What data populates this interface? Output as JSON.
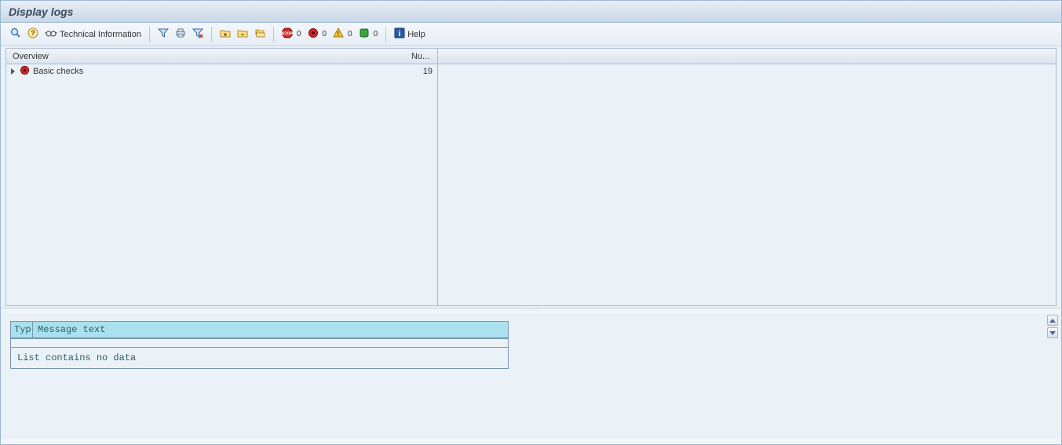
{
  "title": "Display logs",
  "toolbar": {
    "tech_info_label": "Technical Information",
    "help_label": "Help",
    "counts": {
      "stop": "0",
      "error": "0",
      "warning": "0",
      "success": "0"
    }
  },
  "tree": {
    "header_overview": "Overview",
    "header_num": "Nu...",
    "rows": [
      {
        "label": "Basic checks",
        "count": "19"
      }
    ]
  },
  "messages": {
    "header_typ": "Typ",
    "header_text": "Message text",
    "empty_text": "List contains no data"
  }
}
